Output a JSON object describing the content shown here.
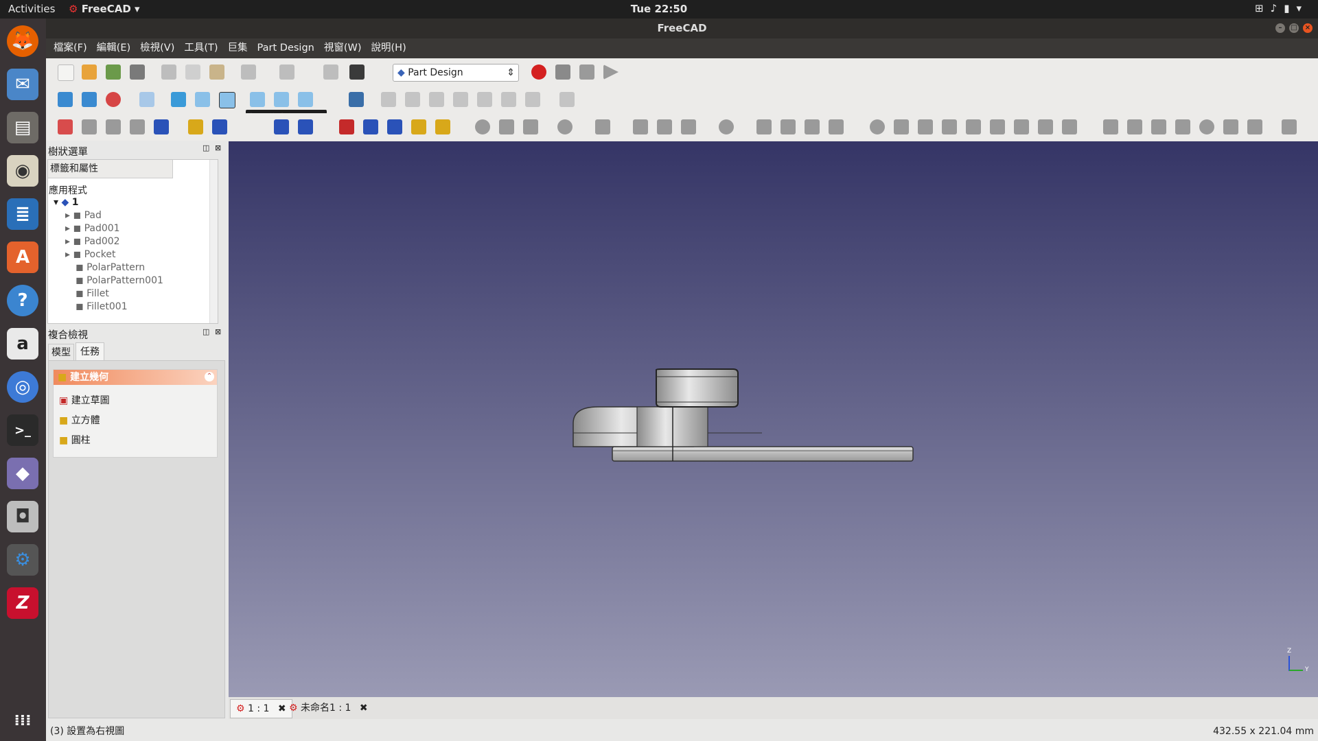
{
  "topbar": {
    "activities": "Activities",
    "app_name": "FreeCAD",
    "clock": "Tue 22:50"
  },
  "window": {
    "title": "FreeCAD"
  },
  "menu": [
    "檔案(F)",
    "編輯(E)",
    "檢視(V)",
    "工具(T)",
    "巨集",
    "Part Design",
    "視窗(W)",
    "說明(H)"
  ],
  "toolbar": {
    "workbench": "Part Design",
    "tooltip": "設置為右視圖 (3)"
  },
  "tree_panel": {
    "title": "樹狀選單",
    "column_header": "標籤和屬性",
    "group": "應用程式",
    "document": "1",
    "items": [
      "Pad",
      "Pad001",
      "Pad002",
      "Pocket",
      "PolarPattern",
      "PolarPattern001",
      "Fillet",
      "Fillet001"
    ]
  },
  "combo_panel": {
    "title": "複合檢視",
    "tabs": [
      "模型",
      "任務"
    ],
    "task_box": {
      "title": "建立幾何",
      "items": [
        "建立草圖",
        "立方體",
        "圓柱"
      ]
    }
  },
  "view_tabs": [
    {
      "label": "1 : 1"
    },
    {
      "label": "未命名1 : 1"
    }
  ],
  "axis": {
    "z": "Z",
    "y": "Y"
  },
  "status": {
    "message": "(3) 設置為右視圖",
    "dimensions": "432.55 x 221.04 mm"
  },
  "colors": {
    "viewport_top": "#353566",
    "viewport_bottom": "#9a9ab4",
    "task_header": "#f08a5d"
  }
}
